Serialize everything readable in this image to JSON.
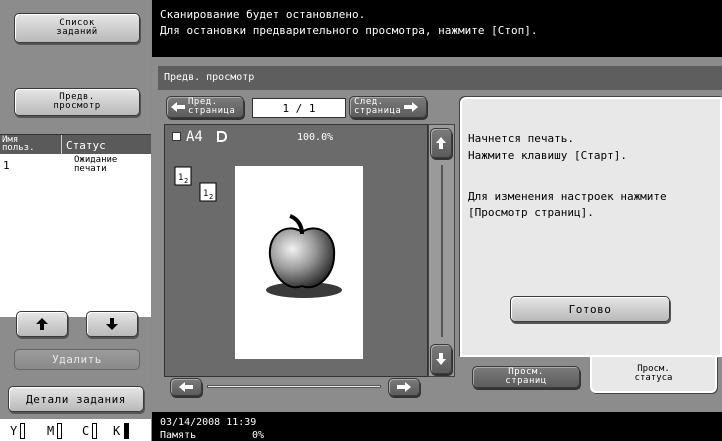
{
  "left_panel": {
    "job_list_button": "Список\nзаданий",
    "preview_button": "Предв.\nпросмотр",
    "table": {
      "col_user": "Имя\nпольз.",
      "col_status": "Статус",
      "rows": [
        {
          "user": "1",
          "status": "Ожидание\nпечати"
        }
      ]
    },
    "delete_button": "Удалить",
    "job_details_button": "Детали задания",
    "toner_labels": [
      "Y",
      "M",
      "C",
      "K"
    ]
  },
  "message": {
    "line1": "Сканирование будет остановлено.",
    "line2": "Для остановки предварительного просмотра, нажмите [Стоп]."
  },
  "main": {
    "title": "Предв. просмотр",
    "prev_page_button": "Пред.\nстраница",
    "next_page_button": "След.\nстраница",
    "page_indicator": "1 /   1",
    "paper_size": "A4",
    "zoom": "100.0%",
    "page_icon": "apple-image"
  },
  "info_panel": {
    "line1": "Начнется печать.",
    "line2": "Нажмите клавишу [Старт].",
    "line3": "Для изменения настроек нажмите",
    "line4": "[Просмотр страниц].",
    "ok_button": "Готово",
    "tab_pages": "Просм.\nстраниц",
    "tab_status": "Просм.\nстатуса"
  },
  "status_bar": {
    "datetime": "03/14/2008    11:39",
    "memory_label": "Память",
    "memory_value": "0%"
  }
}
